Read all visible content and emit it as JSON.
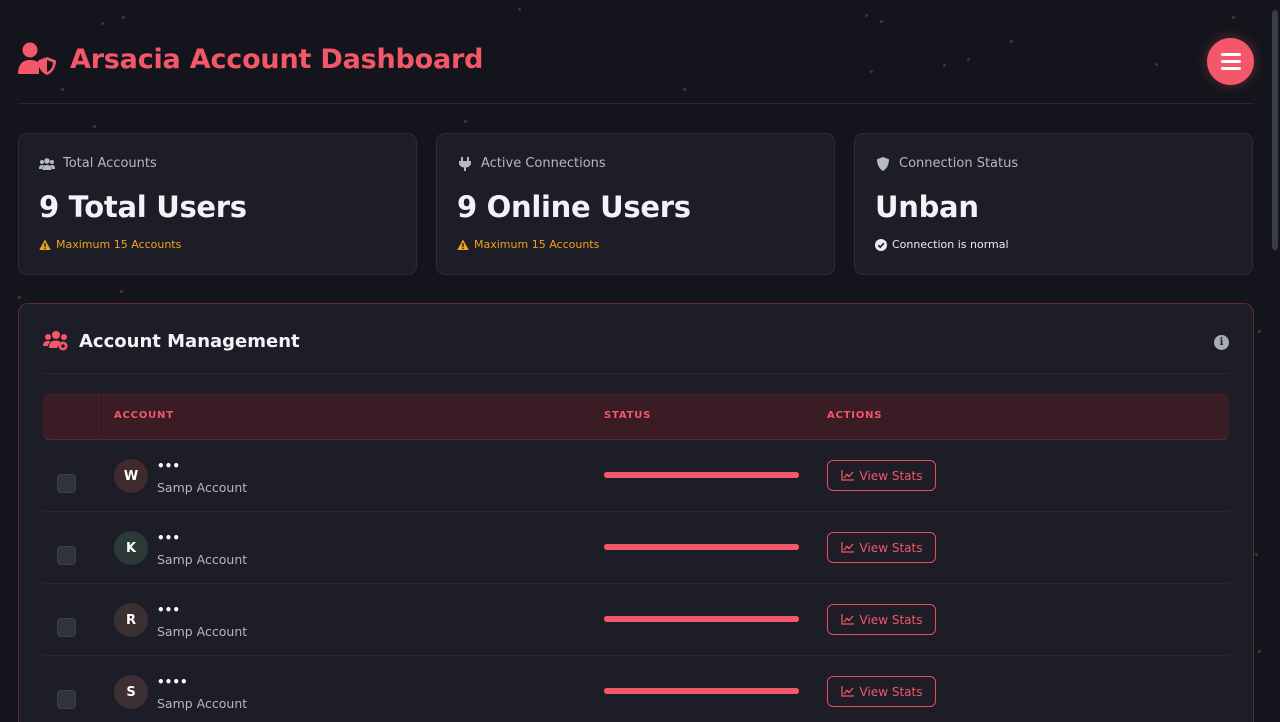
{
  "header": {
    "title": "Arsacia Account Dashboard",
    "brand_icon": "user-shield-icon",
    "menu_icon": "hamburger-icon"
  },
  "cards": [
    {
      "label": "Total Accounts",
      "icon": "users-icon",
      "value": "9 Total Users",
      "note": "Maximum 15 Accounts",
      "note_icon": "warning-icon"
    },
    {
      "label": "Active Connections",
      "icon": "plug-icon",
      "value": "9 Online Users",
      "note": "Maximum 15 Accounts",
      "note_icon": "warning-icon"
    },
    {
      "label": "Connection Status",
      "icon": "shield-icon",
      "value": "Unban",
      "note": "Connection is normal",
      "note_icon": "check-circle-icon"
    }
  ],
  "management": {
    "title": "Account Management",
    "icon": "users-gear-icon",
    "info_icon": "info-icon",
    "columns": {
      "account": "ACCOUNT",
      "status": "STATUS",
      "actions": "ACTIONS"
    },
    "rows": [
      {
        "initial": "W",
        "name": "•••",
        "sub": "Samp Account",
        "status_level": 1.0,
        "action": "View Stats",
        "avatar_color": "#3f2a2e"
      },
      {
        "initial": "K",
        "name": "•••",
        "sub": "Samp Account",
        "status_level": 1.0,
        "action": "View Stats",
        "avatar_color": "#2b3937"
      },
      {
        "initial": "R",
        "name": "•••",
        "sub": "Samp Account",
        "status_level": 1.0,
        "action": "View Stats",
        "avatar_color": "#3a2f31"
      },
      {
        "initial": "S",
        "name": "••••",
        "sub": "Samp Account",
        "status_level": 1.0,
        "action": "View Stats",
        "avatar_color": "#3d2f33"
      }
    ]
  },
  "colors": {
    "accent": "#f4566a",
    "warning": "#f0a21c",
    "background": "#14151c",
    "card": "#1c1d26"
  }
}
